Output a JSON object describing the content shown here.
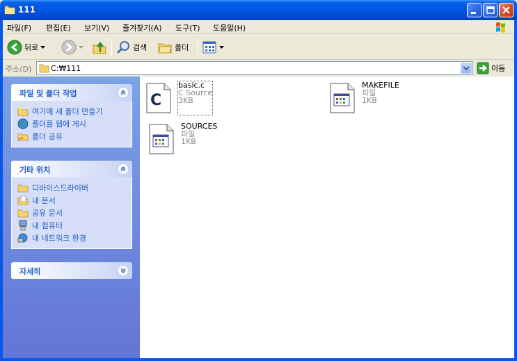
{
  "window": {
    "title": "111"
  },
  "menu": {
    "items": [
      "파일(F)",
      "편집(E)",
      "보기(V)",
      "즐겨찾기(A)",
      "도구(T)",
      "도움말(H)"
    ]
  },
  "toolbar": {
    "back_label": "뒤로",
    "search_label": "검색",
    "folders_label": "폴더"
  },
  "address": {
    "label": "주소(D)",
    "path": "C:₩111",
    "go_label": "이동"
  },
  "taskpane": {
    "file_tasks": {
      "title": "파일 및 폴더 작업",
      "items": [
        "여기에 새 폴더 만들기",
        "폴더를 웹에 게시",
        "폴더 공유"
      ]
    },
    "other_places": {
      "title": "기타 위치",
      "items": [
        "디바이스드라이버",
        "내 문서",
        "공유 문서",
        "내 컴퓨터",
        "내 네트워크 환경"
      ]
    },
    "details": {
      "title": "자세히"
    }
  },
  "files": [
    {
      "name": "basic.c",
      "type": "C Source",
      "size": "3KB"
    },
    {
      "name": "MAKEFILE",
      "type": "파일",
      "size": "1KB"
    },
    {
      "name": "SOURCES",
      "type": "파일",
      "size": "1KB"
    }
  ],
  "colors": {
    "titlebar": "#0055E5",
    "taskpane_link": "#215DC6",
    "taskpane_bg": "#7BA2E7"
  }
}
